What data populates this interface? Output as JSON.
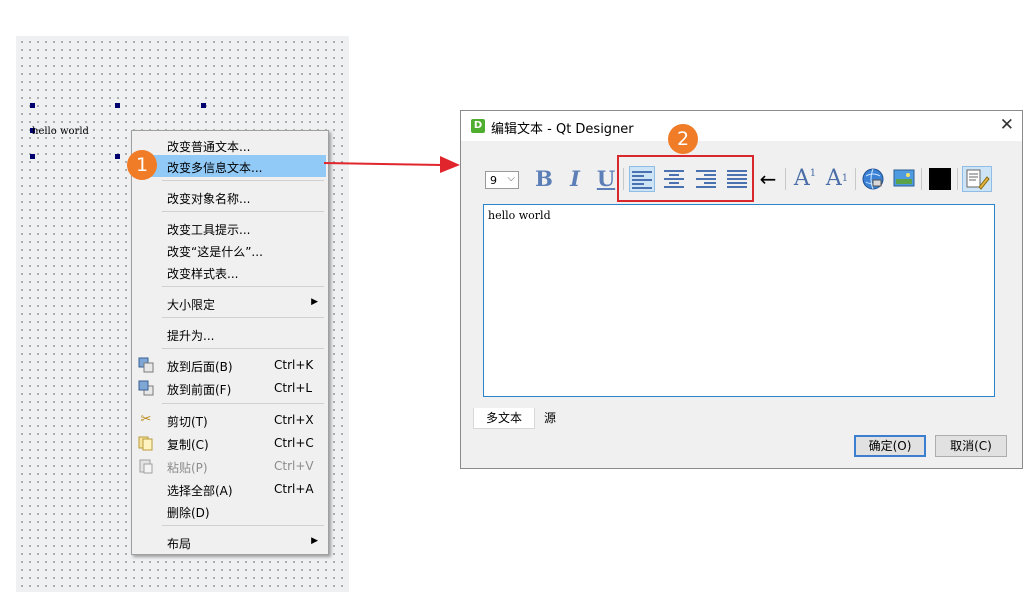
{
  "canvas": {
    "label_text": "hello world"
  },
  "context_menu": {
    "items": [
      {
        "label": "改变普通文本..."
      },
      {
        "label": "改变多信息文本..."
      },
      {
        "label": "改变对象名称..."
      },
      {
        "label": "改变工具提示..."
      },
      {
        "label": "改变“这是什么”..."
      },
      {
        "label": "改变样式表..."
      },
      {
        "label": "大小限定",
        "submenu": true
      },
      {
        "label": "提升为..."
      },
      {
        "label": "放到后面(B)",
        "shortcut": "Ctrl+K",
        "icon": "send-to-back-icon"
      },
      {
        "label": "放到前面(F)",
        "shortcut": "Ctrl+L",
        "icon": "bring-to-front-icon"
      },
      {
        "label": "剪切(T)",
        "shortcut": "Ctrl+X",
        "icon": "scissors-icon"
      },
      {
        "label": "复制(C)",
        "shortcut": "Ctrl+C",
        "icon": "copy-icon"
      },
      {
        "label": "粘贴(P)",
        "shortcut": "Ctrl+V",
        "icon": "paste-icon",
        "disabled": true
      },
      {
        "label": "选择全部(A)",
        "shortcut": "Ctrl+A"
      },
      {
        "label": "删除(D)"
      },
      {
        "label": "布局",
        "submenu": true
      }
    ],
    "highlighted_index": 1
  },
  "badges": {
    "step1": "1",
    "step2": "2"
  },
  "dialog": {
    "title": "编辑文本 - Qt Designer",
    "app_icon_letter": "D",
    "font_size": "9",
    "editor_text": "hello world",
    "tabs": [
      {
        "label": "多文本"
      },
      {
        "label": "源"
      }
    ],
    "ok_label": "确定(O)",
    "cancel_label": "取消(C)"
  },
  "colors": {
    "highlight": "#91c9f7",
    "badge": "#f07c28",
    "annotation_red": "#d9272e",
    "editor_border": "#2b84c9"
  }
}
